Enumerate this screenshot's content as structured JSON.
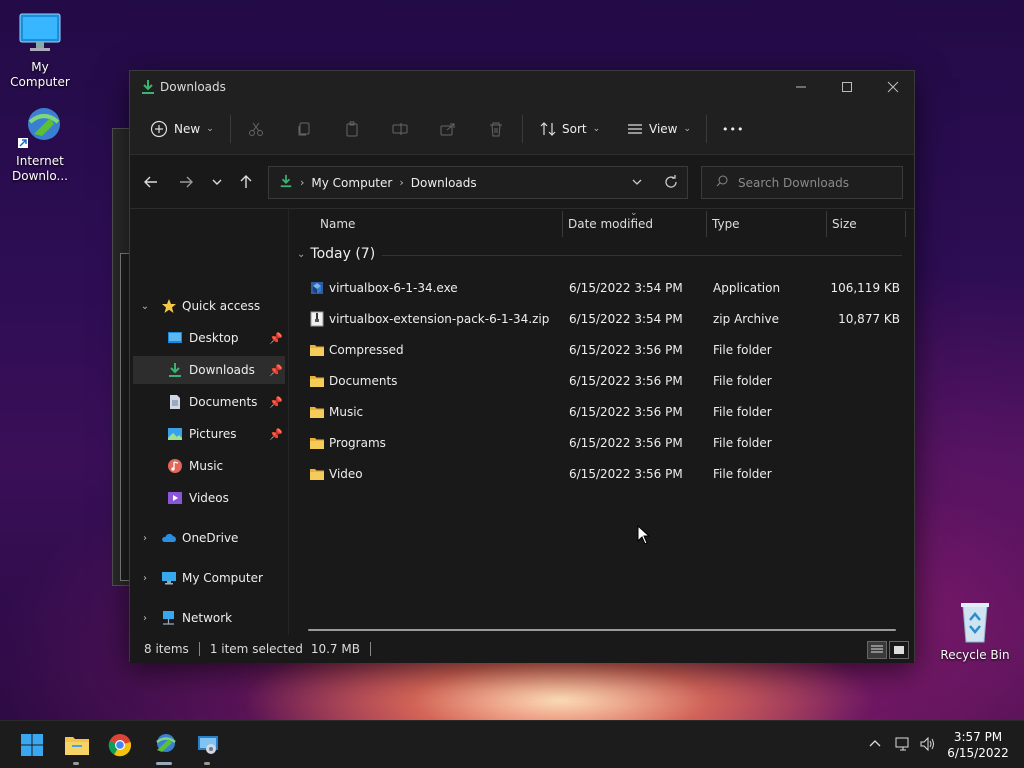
{
  "desktop": {
    "icons": [
      {
        "label": "My Computer"
      },
      {
        "label": "Internet Downlo..."
      },
      {
        "label": "Recycle Bin"
      }
    ]
  },
  "window": {
    "title": "Downloads",
    "toolbar": {
      "new_label": "New",
      "sort_label": "Sort",
      "view_label": "View",
      "more_label": "•••"
    },
    "address": {
      "crumbs": [
        "My Computer",
        "Downloads"
      ]
    },
    "search": {
      "placeholder": "Search Downloads"
    },
    "nav": {
      "quick_access": "Quick access",
      "items": [
        {
          "label": "Desktop",
          "pinned": true
        },
        {
          "label": "Downloads",
          "pinned": true,
          "selected": true
        },
        {
          "label": "Documents",
          "pinned": true
        },
        {
          "label": "Pictures",
          "pinned": true
        },
        {
          "label": "Music"
        },
        {
          "label": "Videos"
        }
      ],
      "onedrive": "OneDrive",
      "mycomputer": "My Computer",
      "network": "Network"
    },
    "columns": {
      "name": "Name",
      "date": "Date modified",
      "type": "Type",
      "size": "Size"
    },
    "group": {
      "label": "Today (7)"
    },
    "files": [
      {
        "name": "virtualbox-6-1-34.exe",
        "date": "6/15/2022 3:54 PM",
        "type": "Application",
        "size": "106,119 KB",
        "icon": "exe-icon"
      },
      {
        "name": "virtualbox-extension-pack-6-1-34.zip",
        "date": "6/15/2022 3:54 PM",
        "type": "zip Archive",
        "size": "10,877 KB",
        "icon": "zip-icon"
      },
      {
        "name": "Compressed",
        "date": "6/15/2022 3:56 PM",
        "type": "File folder",
        "size": "",
        "icon": "folder-icon"
      },
      {
        "name": "Documents",
        "date": "6/15/2022 3:56 PM",
        "type": "File folder",
        "size": "",
        "icon": "folder-icon"
      },
      {
        "name": "Music",
        "date": "6/15/2022 3:56 PM",
        "type": "File folder",
        "size": "",
        "icon": "folder-icon"
      },
      {
        "name": "Programs",
        "date": "6/15/2022 3:56 PM",
        "type": "File folder",
        "size": "",
        "icon": "folder-icon"
      },
      {
        "name": "Video",
        "date": "6/15/2022 3:56 PM",
        "type": "File folder",
        "size": "",
        "icon": "folder-icon"
      }
    ],
    "status": {
      "items": "8 items",
      "selected": "1 item selected",
      "size": "10.7 MB"
    }
  },
  "taskbar": {
    "time": "3:57 PM",
    "date": "6/15/2022"
  },
  "colors": {
    "accent": "#0078d4",
    "folder": "#f3c34a",
    "downloads_green": "#3cb371"
  }
}
